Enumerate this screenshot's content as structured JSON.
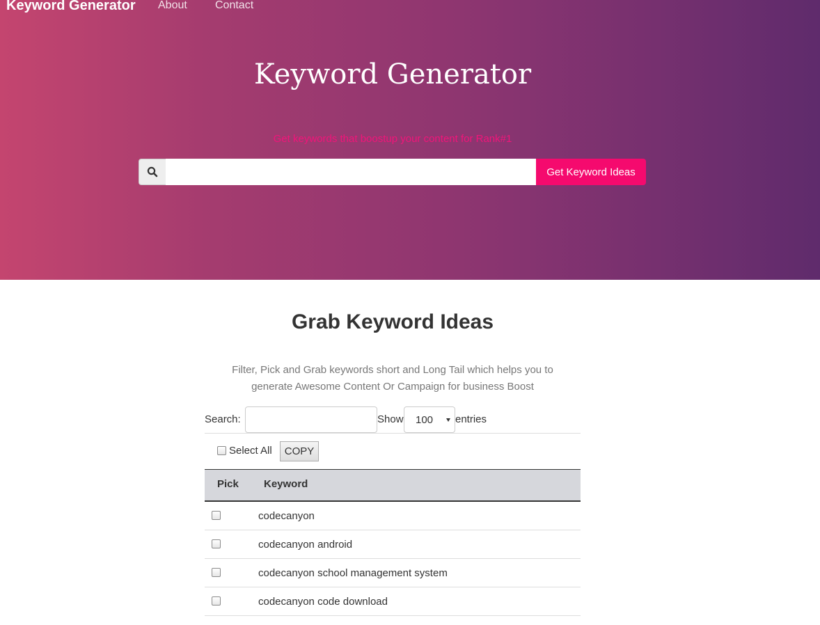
{
  "navbar": {
    "brand": "Keyword Generator",
    "links": [
      "About",
      "Contact"
    ]
  },
  "hero": {
    "title": "Keyword Generator",
    "tagline": "Get keywords that boostup your content for Rank#1",
    "search_placeholder": "",
    "button_label": "Get Keyword Ideas"
  },
  "section": {
    "title": "Grab Keyword Ideas",
    "description": "Filter, Pick and Grab keywords short and Long Tail which helps you to generate Awesome Content Or Campaign for business Boost"
  },
  "filter": {
    "search_label": "Search:",
    "show_label": "Show",
    "entries_value": "100",
    "entries_label": "entries"
  },
  "controls": {
    "select_all_label": "Select All",
    "copy_label": "COPY"
  },
  "table": {
    "columns": [
      "Pick",
      "Keyword"
    ],
    "rows": [
      {
        "keyword": "codecanyon"
      },
      {
        "keyword": "codecanyon android"
      },
      {
        "keyword": "codecanyon school management system"
      },
      {
        "keyword": "codecanyon code download"
      }
    ]
  },
  "colors": {
    "accent": "#f50a6e",
    "gradient_start": "#c4456f",
    "gradient_end": "#5f2b6c"
  },
  "icons": {
    "search": "search-icon"
  }
}
